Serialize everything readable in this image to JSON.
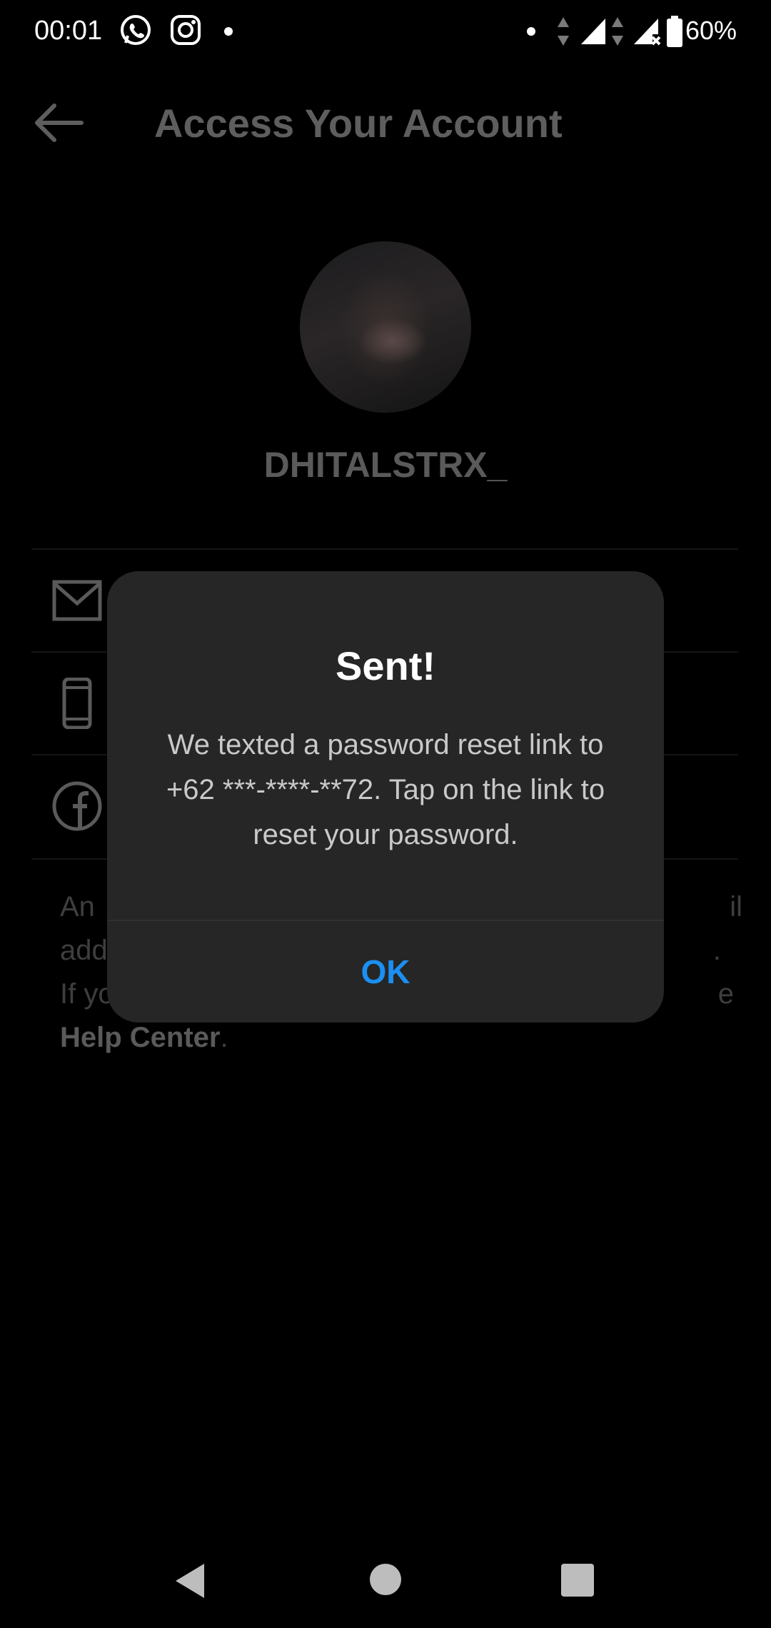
{
  "status_bar": {
    "time": "00:01",
    "icons": [
      "whatsapp-icon",
      "instagram-icon",
      "notification-dot",
      "data-arrows-icon",
      "signal-icon",
      "signal-no-sim-icon",
      "battery-icon"
    ],
    "battery_percent": "60%"
  },
  "header": {
    "back_icon": "arrow-left-icon",
    "title": "Access Your Account"
  },
  "profile": {
    "username": "DHITALSTRX_"
  },
  "options": [
    {
      "icon": "mail-icon"
    },
    {
      "icon": "phone-icon"
    },
    {
      "icon": "facebook-icon"
    }
  ],
  "help_text": {
    "line1_visible_start": "An",
    "line1_visible_end": "il",
    "line2_visible_start": "add",
    "line2_visible_end": ".",
    "line3_visible_start": "If yo",
    "line3_visible_end": "e",
    "link": "Help Center",
    "link_suffix": "."
  },
  "dialog": {
    "title": "Sent!",
    "message": "We texted a password reset link to +62 ***-****-**72. Tap on the link to reset your password.",
    "ok_label": "OK",
    "ok_color": "#1b8ff2"
  },
  "nav": {
    "icons": [
      "nav-back-icon",
      "nav-home-icon",
      "nav-recents-icon"
    ]
  }
}
